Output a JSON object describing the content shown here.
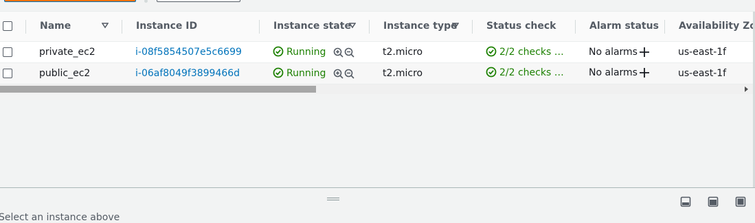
{
  "table": {
    "columns": [
      {
        "label": "Name",
        "sortable": true
      },
      {
        "label": "Instance ID",
        "sortable": false
      },
      {
        "label": "Instance state",
        "sortable": true
      },
      {
        "label": "Instance type",
        "sortable": true
      },
      {
        "label": "Status check",
        "sortable": false
      },
      {
        "label": "Alarm status",
        "sortable": false
      },
      {
        "label": "Availability Zon",
        "sortable": false
      }
    ],
    "rows": [
      {
        "name": "private_ec2",
        "instance_id": "i-08f5854507e5c6699",
        "state": "Running",
        "type": "t2.micro",
        "status_check": "2/2 checks …",
        "alarm": "No alarms",
        "az": "us-east-1f"
      },
      {
        "name": "public_ec2",
        "instance_id": "i-06af8049f3899466d",
        "state": "Running",
        "type": "t2.micro",
        "status_check": "2/2 checks …",
        "alarm": "No alarms",
        "az": "us-east-1f"
      }
    ]
  },
  "split_panel": {
    "hint": "Select an instance above"
  },
  "colors": {
    "link": "#0073bb",
    "success": "#1d8102",
    "header_text": "#545b64"
  },
  "icons": [
    "sort-down-icon",
    "check-circle-icon",
    "zoom-in-icon",
    "zoom-out-icon",
    "plus-icon",
    "drag-handle-icon",
    "panel-bottom-icon",
    "panel-side-icon",
    "panel-hide-icon"
  ]
}
